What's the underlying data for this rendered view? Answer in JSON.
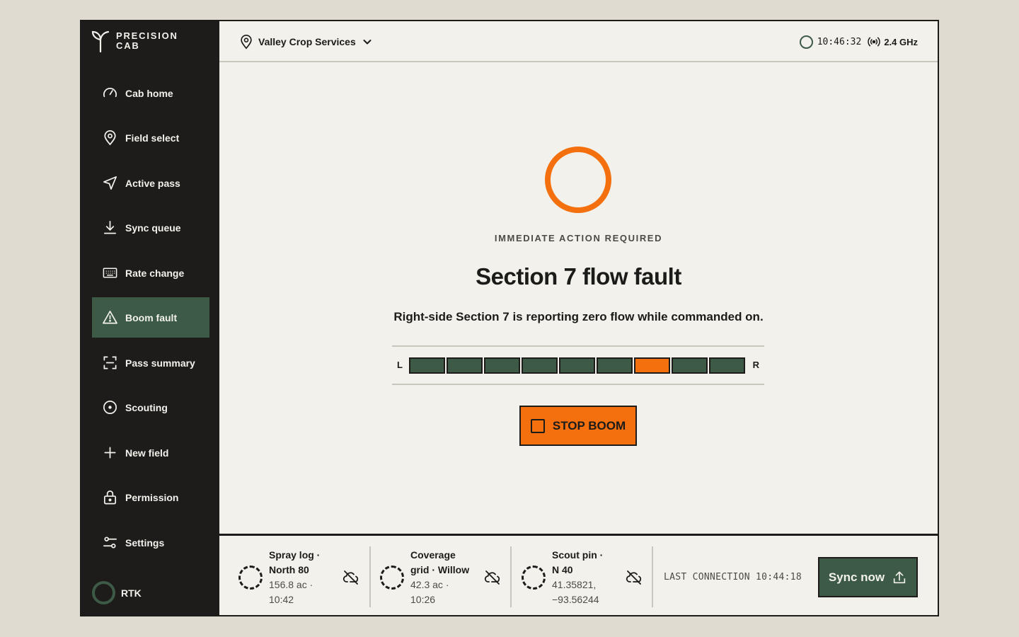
{
  "brand": {
    "line1": "PRECISION",
    "line2": "CAB"
  },
  "sidebar": {
    "items": [
      {
        "label": "Cab home",
        "icon": "gauge-icon"
      },
      {
        "label": "Field select",
        "icon": "map-pin-icon"
      },
      {
        "label": "Active pass",
        "icon": "navigation-icon"
      },
      {
        "label": "Sync queue",
        "icon": "download-icon"
      },
      {
        "label": "Rate change",
        "icon": "keyboard-icon"
      },
      {
        "label": "Boom fault",
        "icon": "warning-icon",
        "active": true
      },
      {
        "label": "Pass summary",
        "icon": "scan-icon"
      },
      {
        "label": "Scouting",
        "icon": "target-icon"
      },
      {
        "label": "New field",
        "icon": "plus-icon"
      },
      {
        "label": "Permission",
        "icon": "lock-icon"
      },
      {
        "label": "Settings",
        "icon": "sliders-icon"
      }
    ],
    "rtk_label": "RTK"
  },
  "topbar": {
    "organization": "Valley Crop Services",
    "clock": "10:46:32",
    "network": "2.4 GHz"
  },
  "alert": {
    "eyebrow": "IMMEDIATE ACTION REQUIRED",
    "title": "Section 7 flow fault",
    "description": "Right-side Section 7 is reporting zero flow while commanded on.",
    "left_label": "L",
    "right_label": "R",
    "sections": [
      {
        "id": 1,
        "status": "ok"
      },
      {
        "id": 2,
        "status": "ok"
      },
      {
        "id": 3,
        "status": "ok"
      },
      {
        "id": 4,
        "status": "ok"
      },
      {
        "id": 5,
        "status": "ok"
      },
      {
        "id": 6,
        "status": "ok"
      },
      {
        "id": 7,
        "status": "fault"
      },
      {
        "id": 8,
        "status": "ok"
      },
      {
        "id": 9,
        "status": "ok"
      }
    ],
    "stop_label": "STOP BOOM",
    "colors": {
      "ok": "#3c5a45",
      "fault": "#f4700e"
    }
  },
  "tray": {
    "queue": [
      {
        "title": "Spray log · North 80",
        "detail": "156.8 ac · 10:42"
      },
      {
        "title": "Coverage grid · Willow",
        "detail": "42.3 ac · 10:26"
      },
      {
        "title": "Scout pin · N 40",
        "detail": "41.35821, −93.56244"
      }
    ],
    "last_connection": "LAST CONNECTION 10:44:18",
    "sync_label": "Sync now"
  }
}
